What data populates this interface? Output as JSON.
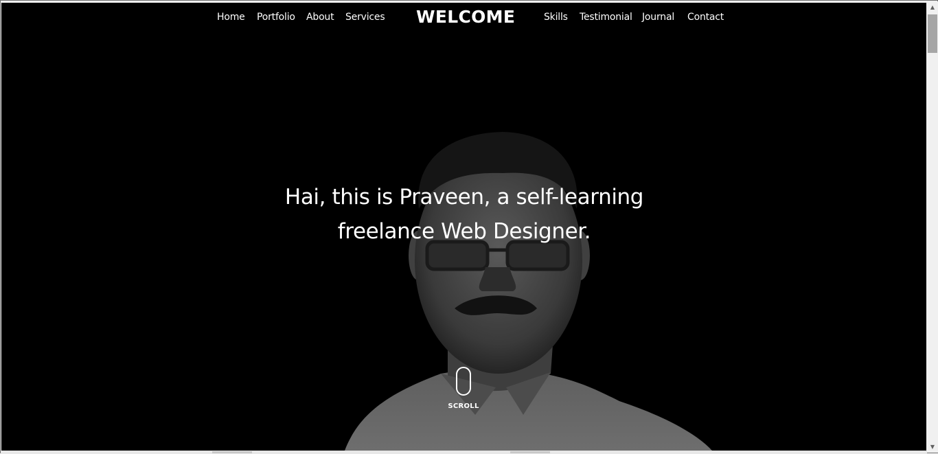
{
  "nav": {
    "left": [
      "Home",
      "Portfolio",
      "About",
      "Services"
    ],
    "brand": "WELCOME",
    "right": [
      "Skills",
      "Testimonial",
      "Journal",
      "Contact"
    ]
  },
  "hero": {
    "line1": "Hai, this is Praveen, a self-learning",
    "line2": "freelance Web Designer."
  },
  "scroll": {
    "label": "SCROLL",
    "icon": "mouse-icon"
  },
  "colors": {
    "background": "#000000",
    "text": "#ffffff"
  }
}
